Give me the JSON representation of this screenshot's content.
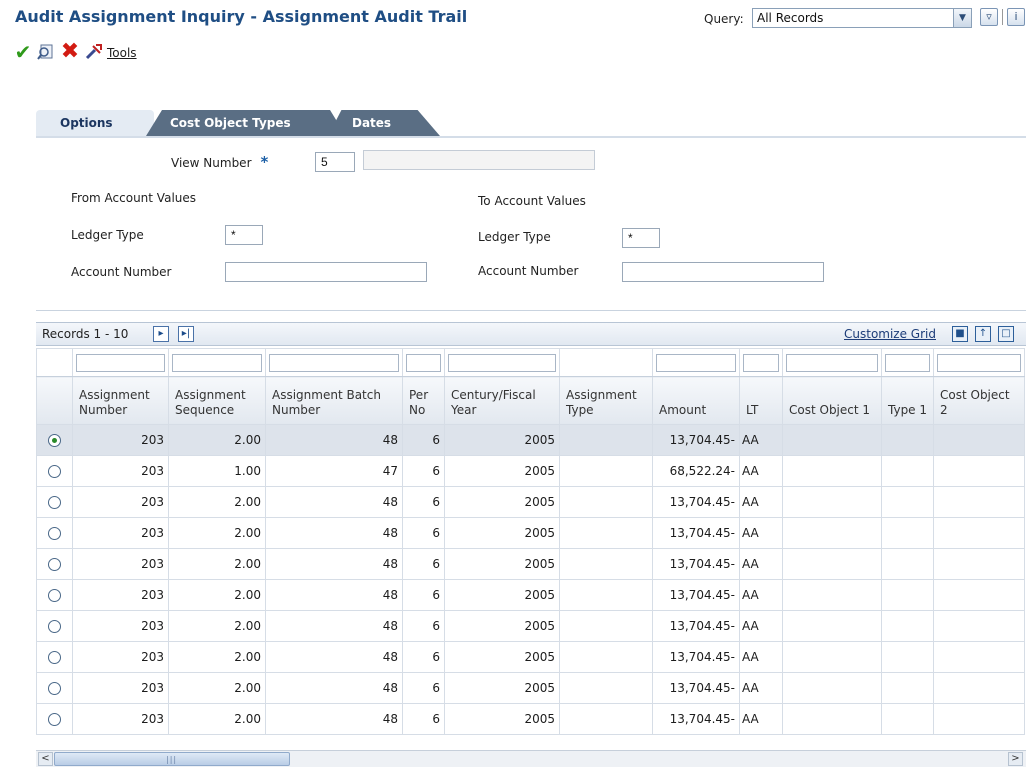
{
  "header": {
    "title": "Audit Assignment Inquiry - Assignment Audit Trail",
    "query_label": "Query:",
    "query_value": "All Records",
    "filter_icon": "filter-icon",
    "info_icon": "info-icon"
  },
  "toolbar": {
    "ok_icon": "checkmark-icon",
    "search_icon": "find-icon",
    "cancel_icon": "cancel-x-icon",
    "tools_icon": "tools-icon",
    "tools_label": "Tools"
  },
  "tabs": [
    {
      "label": "Options",
      "active": true
    },
    {
      "label": "Cost Object Types",
      "active": false
    },
    {
      "label": "Dates",
      "active": false
    }
  ],
  "form": {
    "view_number_label": "View Number",
    "view_number_value": "5",
    "view_number_desc": "",
    "from_section": "From Account Values",
    "to_section": "To Account Values",
    "from_ledger_label": "Ledger Type",
    "from_ledger_value": "*",
    "to_ledger_label": "Ledger Type",
    "to_ledger_value": "*",
    "from_account_label": "Account Number",
    "from_account_value": "",
    "to_account_label": "Account Number",
    "to_account_value": ""
  },
  "grid": {
    "records_label": "Records 1 - 10",
    "customize_label": "Customize Grid",
    "columns": [
      "Assignment Number",
      "Assignment Sequence",
      "Assignment Batch Number",
      "Per No",
      "Century/Fiscal Year",
      "Assignment Type",
      "Amount",
      "LT",
      "Cost Object 1",
      "Type 1",
      "Cost Object 2"
    ],
    "rows": [
      {
        "selected": true,
        "cells": [
          "203",
          "2.00",
          "48",
          "6",
          "2005",
          "",
          "13,704.45-",
          "AA",
          "",
          "",
          ""
        ]
      },
      {
        "selected": false,
        "cells": [
          "203",
          "1.00",
          "47",
          "6",
          "2005",
          "",
          "68,522.24-",
          "AA",
          "",
          "",
          ""
        ]
      },
      {
        "selected": false,
        "cells": [
          "203",
          "2.00",
          "48",
          "6",
          "2005",
          "",
          "13,704.45-",
          "AA",
          "",
          "",
          ""
        ]
      },
      {
        "selected": false,
        "cells": [
          "203",
          "2.00",
          "48",
          "6",
          "2005",
          "",
          "13,704.45-",
          "AA",
          "",
          "",
          ""
        ]
      },
      {
        "selected": false,
        "cells": [
          "203",
          "2.00",
          "48",
          "6",
          "2005",
          "",
          "13,704.45-",
          "AA",
          "",
          "",
          ""
        ]
      },
      {
        "selected": false,
        "cells": [
          "203",
          "2.00",
          "48",
          "6",
          "2005",
          "",
          "13,704.45-",
          "AA",
          "",
          "",
          ""
        ]
      },
      {
        "selected": false,
        "cells": [
          "203",
          "2.00",
          "48",
          "6",
          "2005",
          "",
          "13,704.45-",
          "AA",
          "",
          "",
          ""
        ]
      },
      {
        "selected": false,
        "cells": [
          "203",
          "2.00",
          "48",
          "6",
          "2005",
          "",
          "13,704.45-",
          "AA",
          "",
          "",
          ""
        ]
      },
      {
        "selected": false,
        "cells": [
          "203",
          "2.00",
          "48",
          "6",
          "2005",
          "",
          "13,704.45-",
          "AA",
          "",
          "",
          ""
        ]
      },
      {
        "selected": false,
        "cells": [
          "203",
          "2.00",
          "48",
          "6",
          "2005",
          "",
          "13,704.45-",
          "AA",
          "",
          "",
          ""
        ]
      }
    ]
  }
}
